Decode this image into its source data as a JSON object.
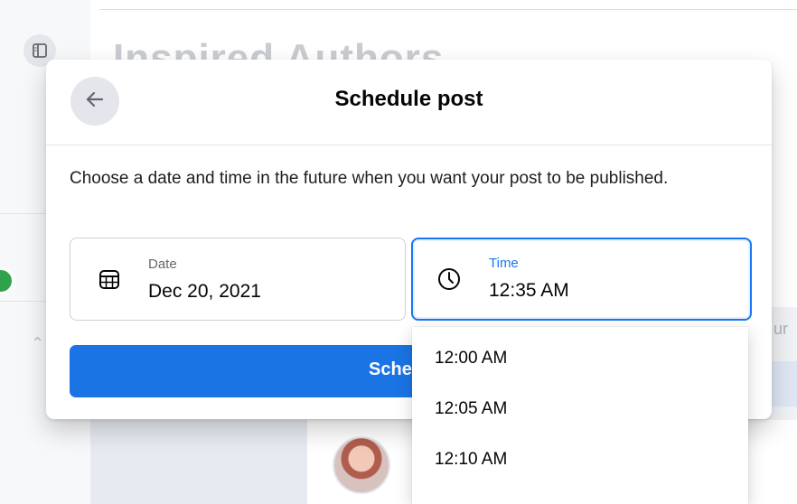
{
  "background": {
    "heading": "Inspired Authors"
  },
  "modal": {
    "title": "Schedule post",
    "back_icon": "arrow-left-icon",
    "instructions": "Choose a date and time in the future when you want your post to be published.",
    "date_field": {
      "icon": "calendar-icon",
      "label": "Date",
      "value": "Dec 20, 2021"
    },
    "time_field": {
      "icon": "clock-icon",
      "label": "Time",
      "value": "12:35 AM"
    },
    "schedule_button": {
      "label": "Schedule"
    }
  },
  "time_dropdown": {
    "options": [
      "12:00 AM",
      "12:05 AM",
      "12:10 AM"
    ]
  },
  "colors": {
    "accent": "#1877f2",
    "button": "#1b74e4",
    "header_bg": "#e4e6eb"
  }
}
